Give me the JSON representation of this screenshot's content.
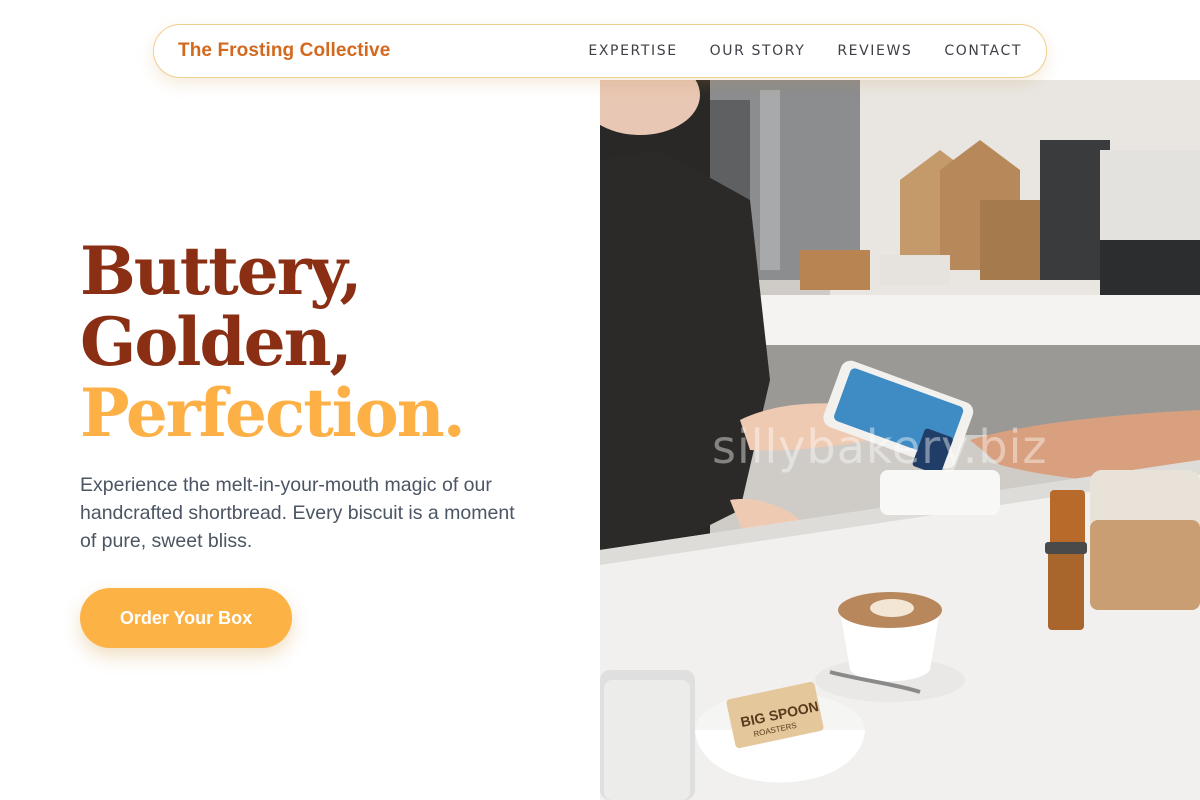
{
  "navbar": {
    "brand": "The Frosting Collective",
    "links": [
      "EXPERTISE",
      "OUR STORY",
      "REVIEWS",
      "CONTACT"
    ]
  },
  "hero": {
    "headline": [
      "Buttery,",
      "Golden,",
      "Perfection."
    ],
    "description": "Experience the melt-in-your-mouth magic of our handcrafted shortbread. Every biscuit is a moment of pure, sweet bliss.",
    "cta_label": "Order Your Box"
  },
  "photo": {
    "watermark": "sillybakery.biz",
    "bag_label_line1": "BIG SPOON",
    "bag_label_line2": "ROASTERS"
  },
  "colors": {
    "brand": "#d2691e",
    "headline_dark": "#8a2e14",
    "headline_accent": "#fdb045",
    "cta": "#fdb245",
    "body_text": "#4b5563"
  }
}
